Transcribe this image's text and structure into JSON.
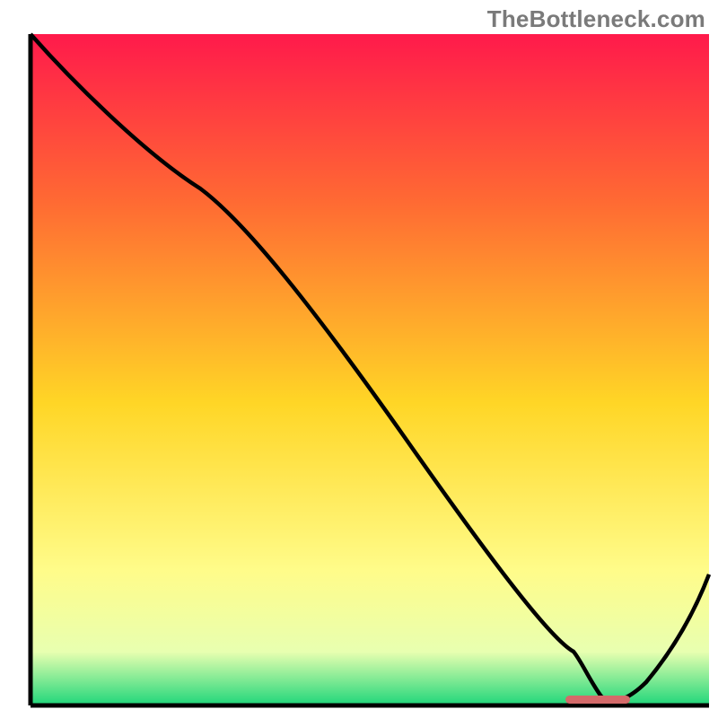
{
  "watermark": "TheBottleneck.com",
  "chart_data": {
    "type": "line",
    "title": "",
    "xlabel": "",
    "ylabel": "",
    "xlim": [
      0,
      100
    ],
    "ylim": [
      0,
      100
    ],
    "grid": false,
    "legend": null,
    "series": [
      {
        "name": "bottleneck-curve",
        "x": [
          0,
          10,
          25,
          40,
          55,
          70,
          80,
          85,
          90,
          100
        ],
        "values": [
          100,
          90,
          77,
          58,
          40,
          22,
          8,
          1,
          5,
          20
        ]
      }
    ],
    "annotations": [
      {
        "name": "optimal-marker",
        "x_start": 79,
        "x_end": 88,
        "y": 0.5
      }
    ],
    "background": {
      "type": "vertical-gradient",
      "stops": [
        {
          "pos": 0.0,
          "color": "#ff1a4b"
        },
        {
          "pos": 0.25,
          "color": "#ff6a33"
        },
        {
          "pos": 0.55,
          "color": "#ffd626"
        },
        {
          "pos": 0.8,
          "color": "#fffc8a"
        },
        {
          "pos": 0.92,
          "color": "#e8ffb0"
        },
        {
          "pos": 1.0,
          "color": "#1fd67a"
        }
      ]
    },
    "colors": {
      "axis": "#000000",
      "curve": "#000000",
      "marker": "#d46a6a"
    }
  }
}
